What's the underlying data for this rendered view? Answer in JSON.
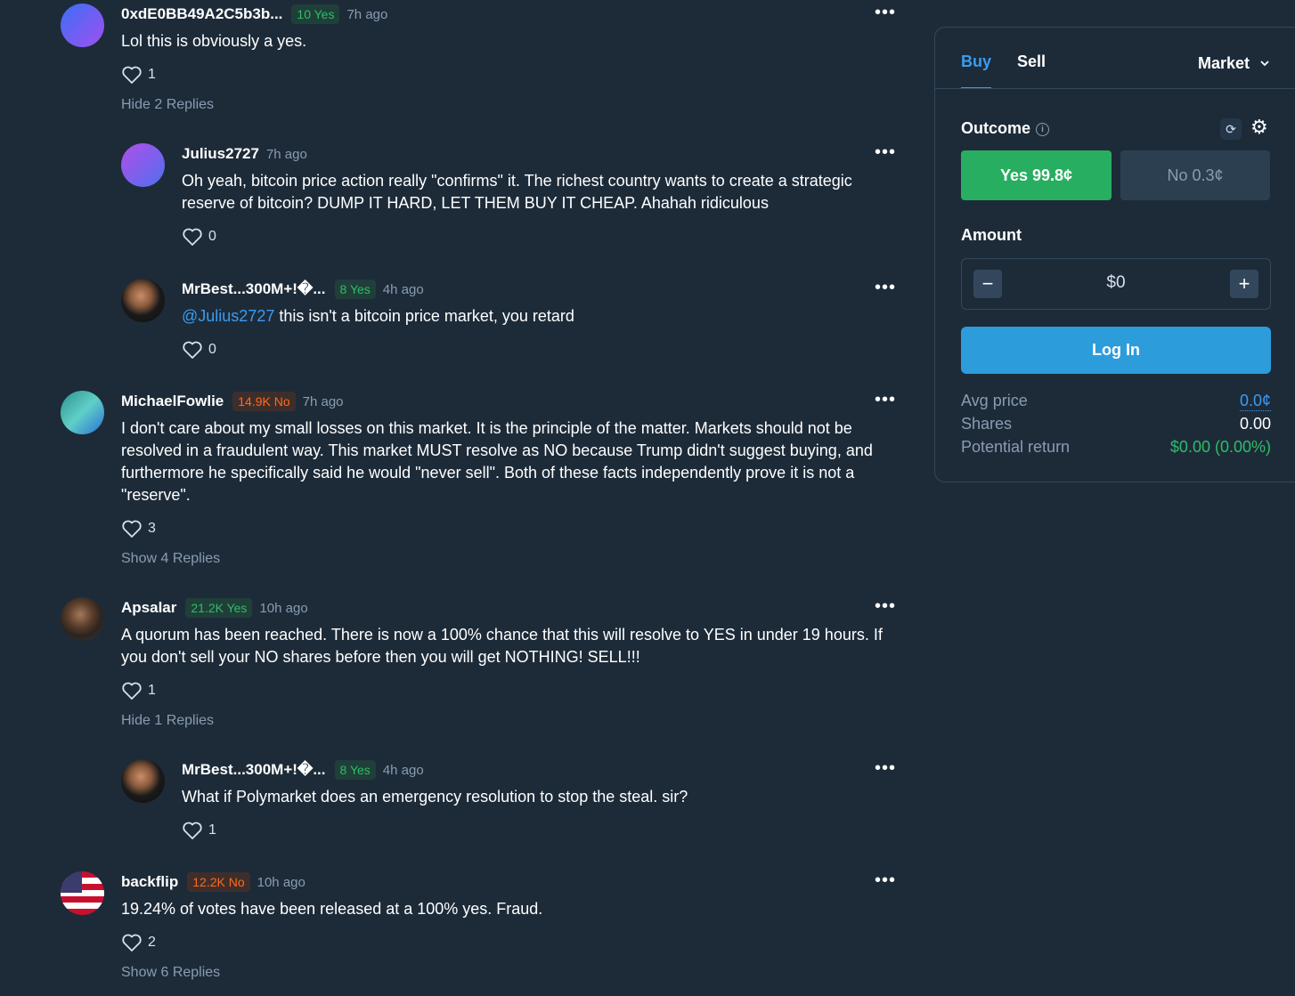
{
  "comments": [
    {
      "username": "0xdE0BB49A2C5b3b...",
      "badge": "10 Yes",
      "time": "7h ago",
      "text": "Lol this is obviously a yes.",
      "likes": "1",
      "toggle": "Hide 2 Replies"
    },
    {
      "username": "Julius2727",
      "time": "7h ago",
      "text": "Oh yeah, bitcoin price action really \"confirms\" it. The richest country wants to create a strategic reserve of bitcoin? DUMP IT HARD, LET THEM BUY IT CHEAP. Ahahah ridiculous",
      "likes": "0"
    },
    {
      "username": "MrBest...300M+!�...",
      "badge": "8 Yes",
      "time": "4h ago",
      "mention": "@Julius2727",
      "text": " this isn't a bitcoin price market, you retard",
      "likes": "0"
    },
    {
      "username": "MichaelFowlie",
      "badge": "14.9K No",
      "time": "7h ago",
      "text": "I don't care about my small losses on this market. It is the principle of the matter. Markets should not be resolved in a fraudulent way. This market MUST resolve as NO because Trump didn't suggest buying, and furthermore he specifically said he would \"never sell\". Both of these facts independently prove it is not a \"reserve\".",
      "likes": "3",
      "toggle": "Show 4 Replies"
    },
    {
      "username": "Apsalar",
      "badge": "21.2K Yes",
      "time": "10h ago",
      "text": "A quorum has been reached. There is now a 100% chance that this will resolve to YES in under 19 hours. If you don't sell your NO shares before then you will get NOTHING! SELL!!!",
      "likes": "1",
      "toggle": "Hide 1 Replies"
    },
    {
      "username": "MrBest...300M+!�...",
      "badge": "8 Yes",
      "time": "4h ago",
      "text": "What if Polymarket does an emergency resolution to stop the steal. sir?",
      "likes": "1"
    },
    {
      "username": "backflip",
      "badge": "12.2K No",
      "time": "10h ago",
      "text": "19.24% of votes have been released at a 100% yes. Fraud.",
      "likes": "2",
      "toggle": "Show 6 Replies"
    }
  ],
  "more_label": "•••",
  "panel": {
    "tab_buy": "Buy",
    "tab_sell": "Sell",
    "order_type": "Market",
    "outcome_label": "Outcome",
    "yes_label": "Yes 99.8¢",
    "no_label": "No 0.3¢",
    "amount_label": "Amount",
    "amount_value": "$0",
    "minus": "−",
    "plus": "+",
    "login": "Log In",
    "avg_price_label": "Avg price",
    "avg_price_value": "0.0¢",
    "shares_label": "Shares",
    "shares_value": "0.00",
    "return_label": "Potential return",
    "return_value": "$0.00 (0.00%)"
  },
  "colors": {
    "background": "#1d2b39",
    "yes_green": "#27ae60",
    "no_orange": "#ff6a1a",
    "accent_blue": "#2d9cdb"
  }
}
